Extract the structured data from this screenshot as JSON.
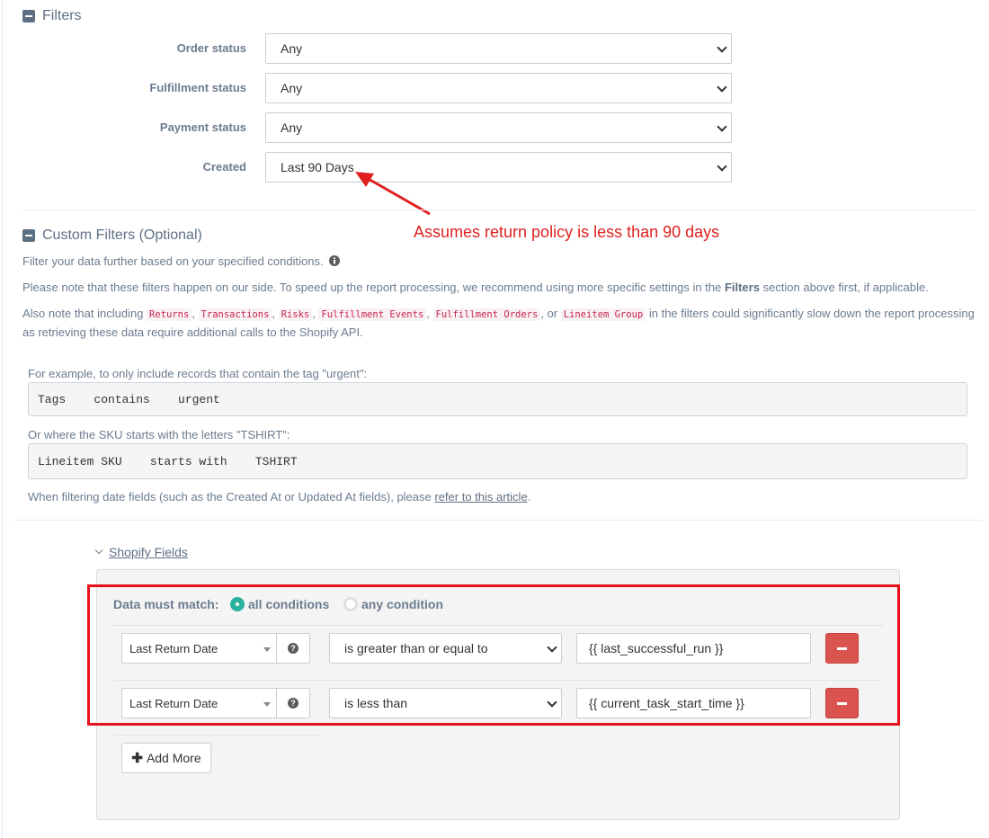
{
  "filters": {
    "title": "Filters",
    "rows": [
      {
        "label": "Order status",
        "value": "Any"
      },
      {
        "label": "Fulfillment status",
        "value": "Any"
      },
      {
        "label": "Payment status",
        "value": "Any"
      },
      {
        "label": "Created",
        "value": "Last 90 Days"
      }
    ]
  },
  "annotation": {
    "text": "Assumes return policy is less than 90 days",
    "color": "#e02020"
  },
  "custom_filters": {
    "title": "Custom Filters (Optional)",
    "intro": "Filter your data further based on your specified conditions.",
    "note1_pre": "Please note that these filters happen on our side. To speed up the report processing, we recommend using more specific settings in the ",
    "note1_bold": "Filters",
    "note1_post": " section above first, if applicable.",
    "note2_pre": "Also note that including ",
    "tags": [
      "Returns",
      "Transactions",
      "Risks",
      "Fulfillment Events",
      "Fulfillment Orders",
      "Lineitem Group"
    ],
    "sep_comma": ", ",
    "sep_or": ", or ",
    "note2_post": " in the filters could significantly slow down the report processing as retrieving these data require additional calls to the Shopify API.",
    "example1_label": "For example, to only include records that contain the tag \"urgent\":",
    "example1_code": "Tags    contains    urgent",
    "example2_label": "Or where the SKU starts with the letters \"TSHIRT\":",
    "example2_code": "Lineitem SKU    starts with    TSHIRT",
    "date_note_pre": "When filtering date fields (such as the Created At or Updated At fields), please ",
    "date_note_link": "refer to this article",
    "date_note_post": "."
  },
  "shopify_fields": {
    "toggle_label": "Shopify Fields",
    "match_label": "Data must match:",
    "match_all": "all conditions",
    "match_any": "any condition",
    "match_selected": "all conditions",
    "conditions": [
      {
        "field": "Last Return Date",
        "operator": "is greater than or equal to",
        "value": "{{ last_successful_run }}"
      },
      {
        "field": "Last Return Date",
        "operator": "is less than",
        "value": "{{ current_task_start_time }}"
      }
    ],
    "add_more": "Add More"
  },
  "colors": {
    "accent_teal": "#2bb3a0",
    "danger": "#d9534f",
    "highlight_border": "#e8101b"
  }
}
